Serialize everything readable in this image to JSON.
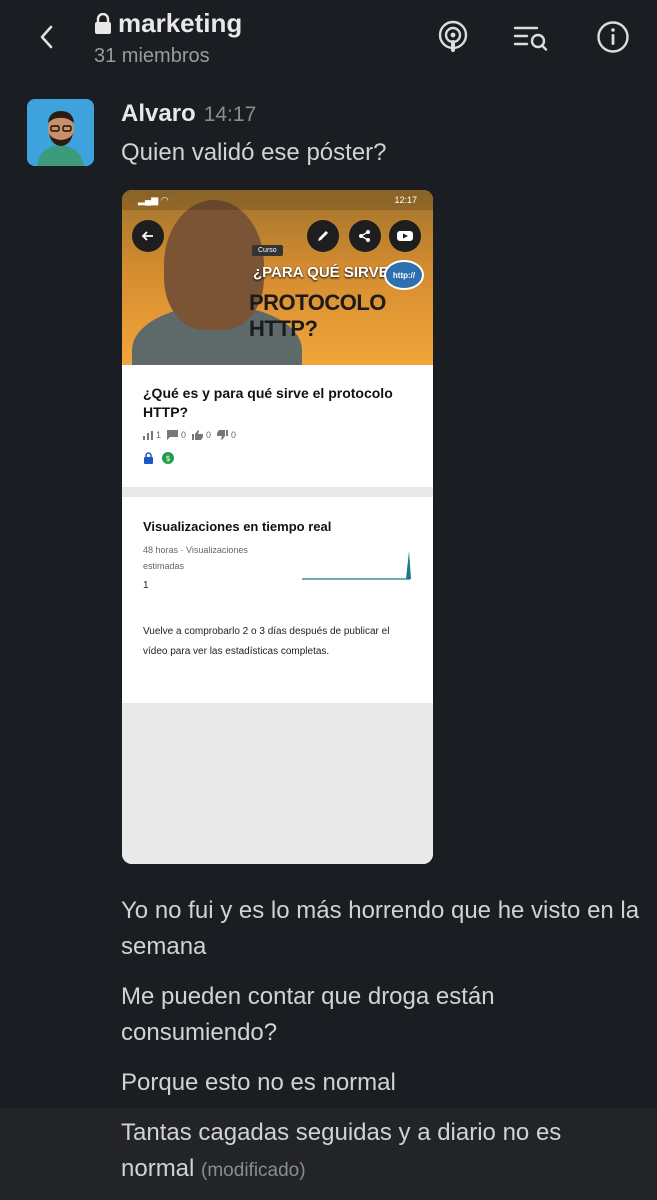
{
  "header": {
    "channel_name": "marketing",
    "members": "31 miembros"
  },
  "message": {
    "author": "Alvaro",
    "time": "14:17",
    "text": "Quien validó ese póster?",
    "attachment": {
      "status_time": "12:17",
      "thumbnail": {
        "tag": "Curso",
        "line1": "¿PARA QUÉ SIRVE EL",
        "line2": "PROTOCOLO HTTP?",
        "badge": "http://"
      },
      "video_title": "¿Qué es y para qué sirve el protocolo HTTP?",
      "stats": {
        "views": "1",
        "comments": "0",
        "likes": "0",
        "dislikes": "0"
      },
      "realtime": {
        "title": "Visualizaciones en tiempo real",
        "subtitle": "48 horas · Visualizaciones estimadas",
        "value": "1",
        "note": "Vuelve a comprobarlo 2 o 3 días después de publicar el vídeo para ver las estadísticas completas."
      }
    }
  },
  "followups": [
    {
      "text": "Yo no fui y es lo más horrendo que he visto en la semana"
    },
    {
      "text": "Me pueden contar que droga están consumiendo?"
    },
    {
      "text": "Porque esto no es normal"
    },
    {
      "text": "Tantas cagadas seguidas y a diario no es normal",
      "edited": "(modificado)"
    }
  ],
  "colors": {
    "background": "#1a1d21",
    "text": "#d1d2d3",
    "muted": "#8b8c8e",
    "thumbnail": "#f0a437"
  },
  "icons": [
    "back-icon",
    "lock-icon",
    "huddle-icon",
    "search-list-icon",
    "info-icon"
  ]
}
